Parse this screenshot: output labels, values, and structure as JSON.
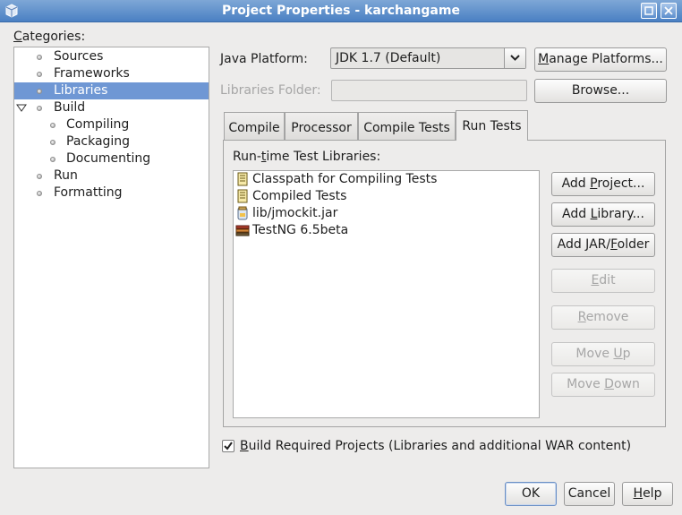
{
  "window": {
    "title": "Project Properties - karchangame"
  },
  "icons": {
    "app": "netbeans-cube-icon",
    "restore": "restore-icon",
    "close": "close-icon",
    "bullet": "bullet-icon",
    "expander": "expander-down-icon",
    "dropdown": "chevron-down-icon",
    "classpath": "jar-classpath-icon",
    "compiled": "compiled-tests-icon",
    "jar": "jar-file-icon",
    "library": "library-books-icon",
    "check": "checkmark-icon"
  },
  "colors": {
    "titlebar": "#4a80c3",
    "selection": "#6f97d4"
  },
  "categories": {
    "label_underline": "C",
    "label_rest": "ategories:",
    "items": [
      {
        "label": "Sources",
        "level": 1
      },
      {
        "label": "Frameworks",
        "level": 1
      },
      {
        "label": "Libraries",
        "level": 1,
        "selected": true
      },
      {
        "label": "Build",
        "level": 1,
        "expanded": true
      },
      {
        "label": "Compiling",
        "level": 2
      },
      {
        "label": "Packaging",
        "level": 2
      },
      {
        "label": "Documenting",
        "level": 2
      },
      {
        "label": "Run",
        "level": 1
      },
      {
        "label": "Formatting",
        "level": 1
      }
    ]
  },
  "java_platform": {
    "label_underline": "J",
    "label_rest": "ava Platform:",
    "value": "JDK 1.7 (Default)",
    "manage_button_underline": "M",
    "manage_button_rest": "anage Platforms..."
  },
  "libraries_folder": {
    "label": "Libraries Folder:",
    "value": "",
    "browse_button": "Browse..."
  },
  "tabs": [
    {
      "label": "Compile"
    },
    {
      "label": "Processor"
    },
    {
      "label": "Compile Tests"
    },
    {
      "label": "Run Tests",
      "active": true
    }
  ],
  "runtime_libraries": {
    "label_a": "Run-",
    "label_underline": "t",
    "label_b": "ime Test Libraries:",
    "items": [
      {
        "label": "Classpath for Compiling Tests"
      },
      {
        "label": "Compiled Tests"
      },
      {
        "label": "lib/jmockit.jar"
      },
      {
        "label": "TestNG 6.5beta"
      }
    ]
  },
  "side_buttons": {
    "add_project": {
      "a": "Add ",
      "u": "P",
      "b": "roject..."
    },
    "add_library": {
      "a": "Add ",
      "u": "L",
      "b": "ibrary..."
    },
    "add_jar": {
      "a": "Add JAR/",
      "u": "F",
      "b": "older"
    },
    "edit": {
      "a": "",
      "u": "E",
      "b": "dit"
    },
    "remove": {
      "a": "",
      "u": "R",
      "b": "emove"
    },
    "move_up": {
      "a": "Move ",
      "u": "U",
      "b": "p"
    },
    "move_down": {
      "a": "Move ",
      "u": "D",
      "b": "own"
    }
  },
  "build_required": {
    "checked": true,
    "label_underline": "B",
    "label_rest": "uild Required Projects (Libraries and additional WAR content)"
  },
  "footer": {
    "ok": "OK",
    "cancel": "Cancel",
    "help_underline": "H",
    "help_rest": "elp"
  }
}
